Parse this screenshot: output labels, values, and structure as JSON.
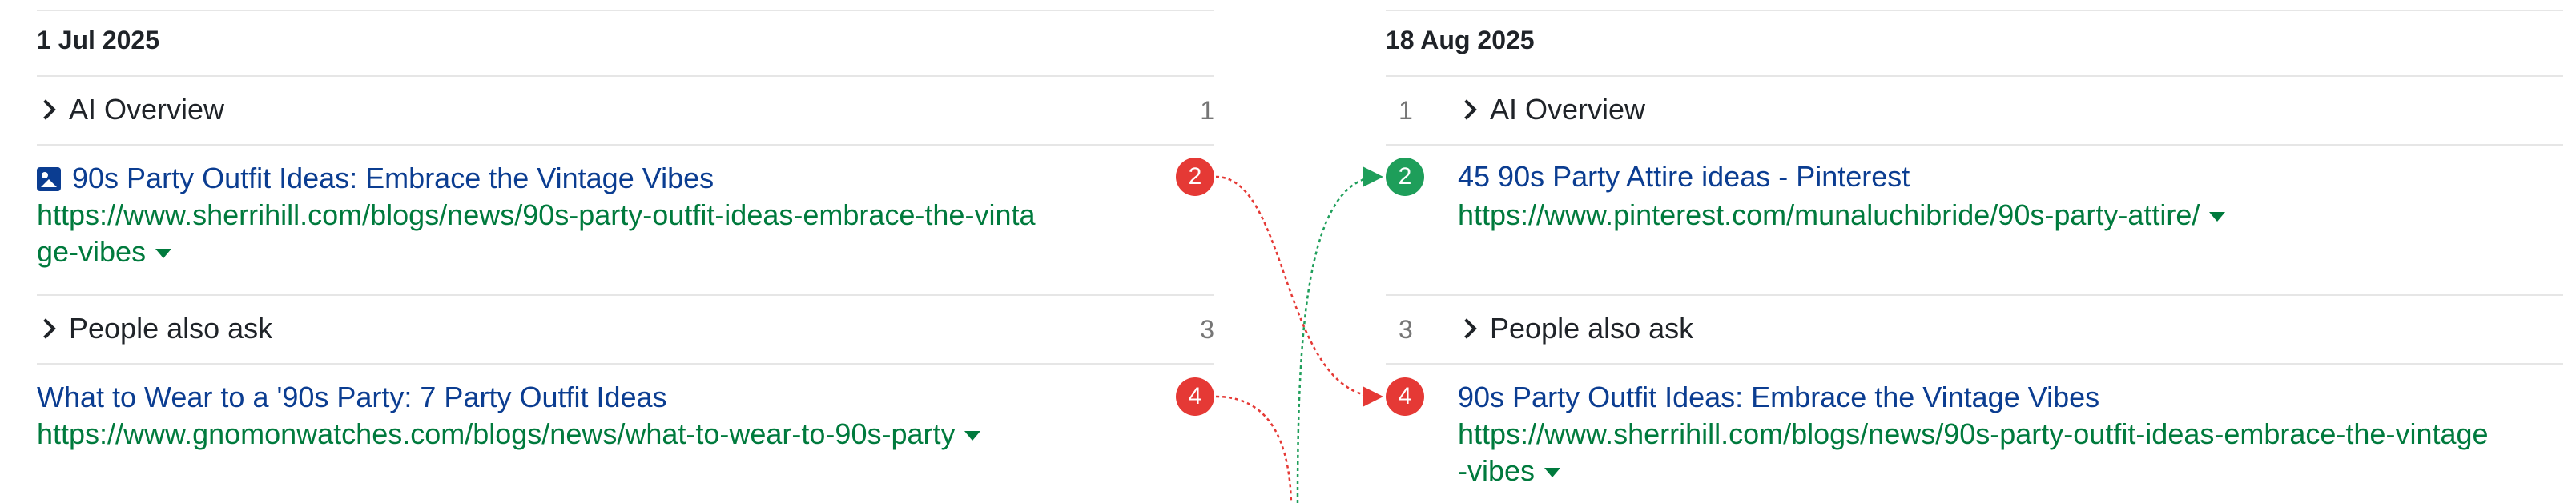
{
  "colors": {
    "title_link": "#0b3d91",
    "url": "#007a3d",
    "badge_red": "#e53935",
    "badge_green": "#1e9e5a",
    "divider": "#e6e6e6"
  },
  "left": {
    "date": "1 Jul 2025",
    "rows": {
      "ai_overview": {
        "label": "AI Overview",
        "pos": "1"
      },
      "result_2": {
        "badge": "2",
        "icon": "image-icon",
        "title": "90s Party Outfit Ideas: Embrace the Vintage Vibes",
        "url_line1": "https://www.sherrihill.com/blogs/news/90s-party-outfit-ideas-embrace-the-vinta",
        "url_line2": "ge-vibes"
      },
      "people_also_ask": {
        "label": "People also ask",
        "pos": "3"
      },
      "result_4": {
        "badge": "4",
        "title": "What to Wear to a '90s Party: 7 Party Outfit Ideas",
        "url": "https://www.gnomonwatches.com/blogs/news/what-to-wear-to-90s-party"
      }
    }
  },
  "right": {
    "date": "18 Aug 2025",
    "rows": {
      "ai_overview": {
        "label": "AI Overview",
        "pos": "1"
      },
      "result_2": {
        "badge": "2",
        "title": "45 90s Party Attire ideas - Pinterest",
        "url": "https://www.pinterest.com/munaluchibride/90s-party-attire/"
      },
      "people_also_ask": {
        "label": "People also ask",
        "pos": "3"
      },
      "result_4": {
        "badge": "4",
        "title": "90s Party Outfit Ideas: Embrace the Vintage Vibes",
        "url_line1": "https://www.sherrihill.com/blogs/news/90s-party-outfit-ideas-embrace-the-vintage",
        "url_line2": "-vibes"
      }
    }
  }
}
